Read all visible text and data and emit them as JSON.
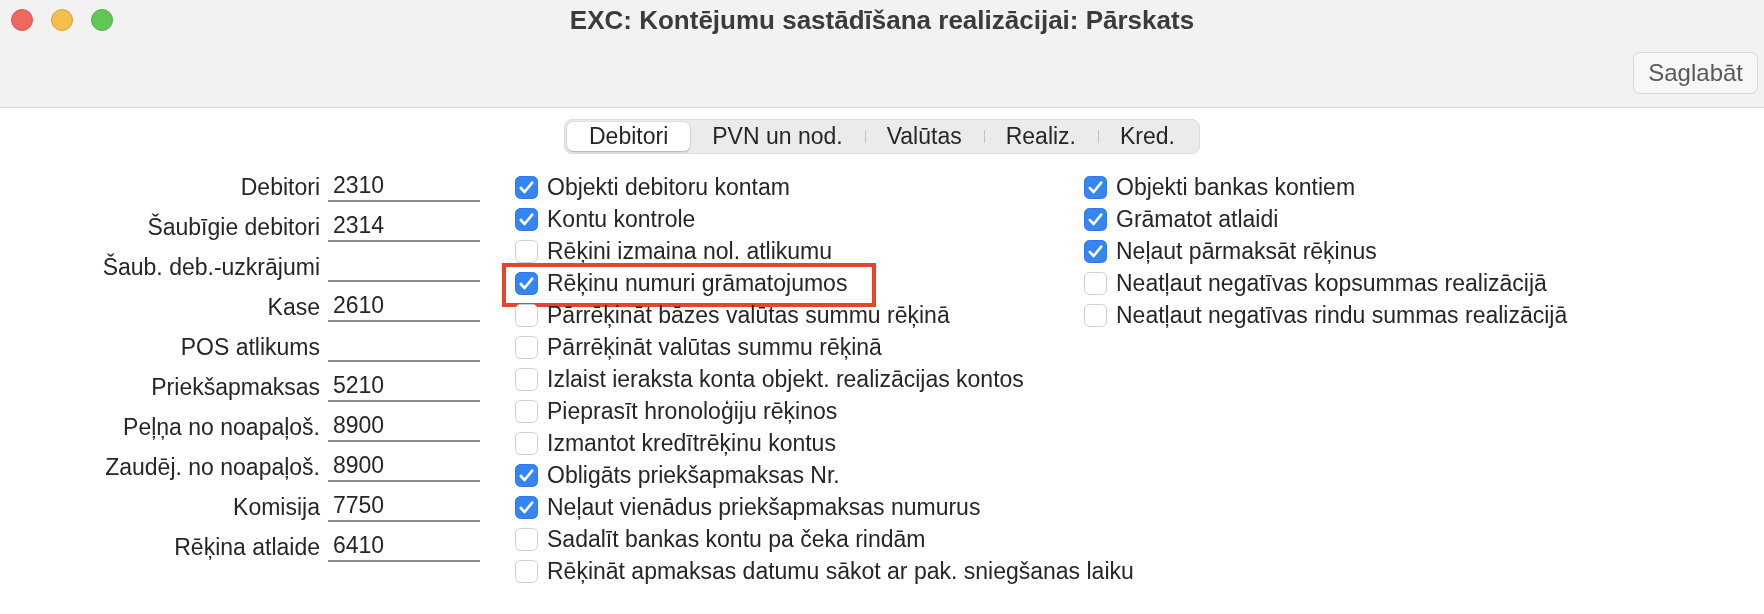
{
  "window": {
    "title": "EXC: Kontējumu sastādīšana realizācijai: Pārskats"
  },
  "toolbar": {
    "buttons": [
      "Saglabāt"
    ]
  },
  "tabs": [
    {
      "label": "Debitori",
      "selected": true
    },
    {
      "label": "PVN un nod.",
      "selected": false
    },
    {
      "label": "Valūtas",
      "selected": false
    },
    {
      "label": "Realiz.",
      "selected": false
    },
    {
      "label": "Kred.",
      "selected": false
    }
  ],
  "accounts": [
    {
      "label": "Debitori",
      "value": "2310"
    },
    {
      "label": "Šaubīgie debitori",
      "value": "2314"
    },
    {
      "label": "Šaub. deb.-uzkrājumi"
    },
    {
      "label": "Kase",
      "value": "2610"
    },
    {
      "label": "POS atlikums"
    },
    {
      "label": "Priekšapmaksas",
      "value": "5210"
    },
    {
      "label": "Peļņa no noapaļoš.",
      "value": "8900"
    },
    {
      "label": "Zaudēj. no noapaļoš.",
      "value": "8900"
    },
    {
      "label": "Komisija",
      "value": "7750"
    },
    {
      "label": "Rēķina atlaide",
      "value": "6410"
    }
  ],
  "options_left": [
    {
      "label": "Objekti debitoru kontam",
      "checked": true,
      "highlighted": false
    },
    {
      "label": "Kontu kontrole",
      "checked": true,
      "highlighted": false
    },
    {
      "label": "Rēķini izmaina nol. atlikumu",
      "checked": false,
      "highlighted": false
    },
    {
      "label": "Rēķinu numuri grāmatojumos",
      "checked": true,
      "highlighted": true
    },
    {
      "label": "Pārrēķināt bāzes valūtas summu rēķinā",
      "checked": false,
      "highlighted": false
    },
    {
      "label": "Pārrēķināt valūtas summu rēķinā",
      "checked": false,
      "highlighted": false
    },
    {
      "label": "Izlaist ieraksta konta objekt. realizācijas kontos",
      "checked": false,
      "highlighted": false
    },
    {
      "label": "Pieprasīt hronoloģiju rēķinos",
      "checked": false,
      "highlighted": false
    },
    {
      "label": "Izmantot kredītrēķinu kontus",
      "checked": false,
      "highlighted": false
    },
    {
      "label": "Obligāts priekšapmaksas Nr.",
      "checked": true,
      "highlighted": false
    },
    {
      "label": "Neļaut vienādus priekšapmaksas numurus",
      "checked": true,
      "highlighted": false
    },
    {
      "label": "Sadalīt bankas kontu pa čeka rindām",
      "checked": false,
      "highlighted": false
    },
    {
      "label": "Rēķināt apmaksas datumu sākot ar pak. sniegšanas laiku",
      "checked": false,
      "highlighted": false
    }
  ],
  "options_right": [
    {
      "label": "Objekti bankas kontiem",
      "checked": true,
      "highlighted": false
    },
    {
      "label": "Grāmatot atlaidi",
      "checked": true,
      "highlighted": false
    },
    {
      "label": "Neļaut pārmaksāt rēķinus",
      "checked": true,
      "highlighted": false
    },
    {
      "label": "Neatļaut negatīvas kopsummas realizācijā",
      "checked": false,
      "highlighted": false
    },
    {
      "label": "Neatļaut negatīvas rindu summas realizācijā",
      "checked": false,
      "highlighted": false
    }
  ]
}
